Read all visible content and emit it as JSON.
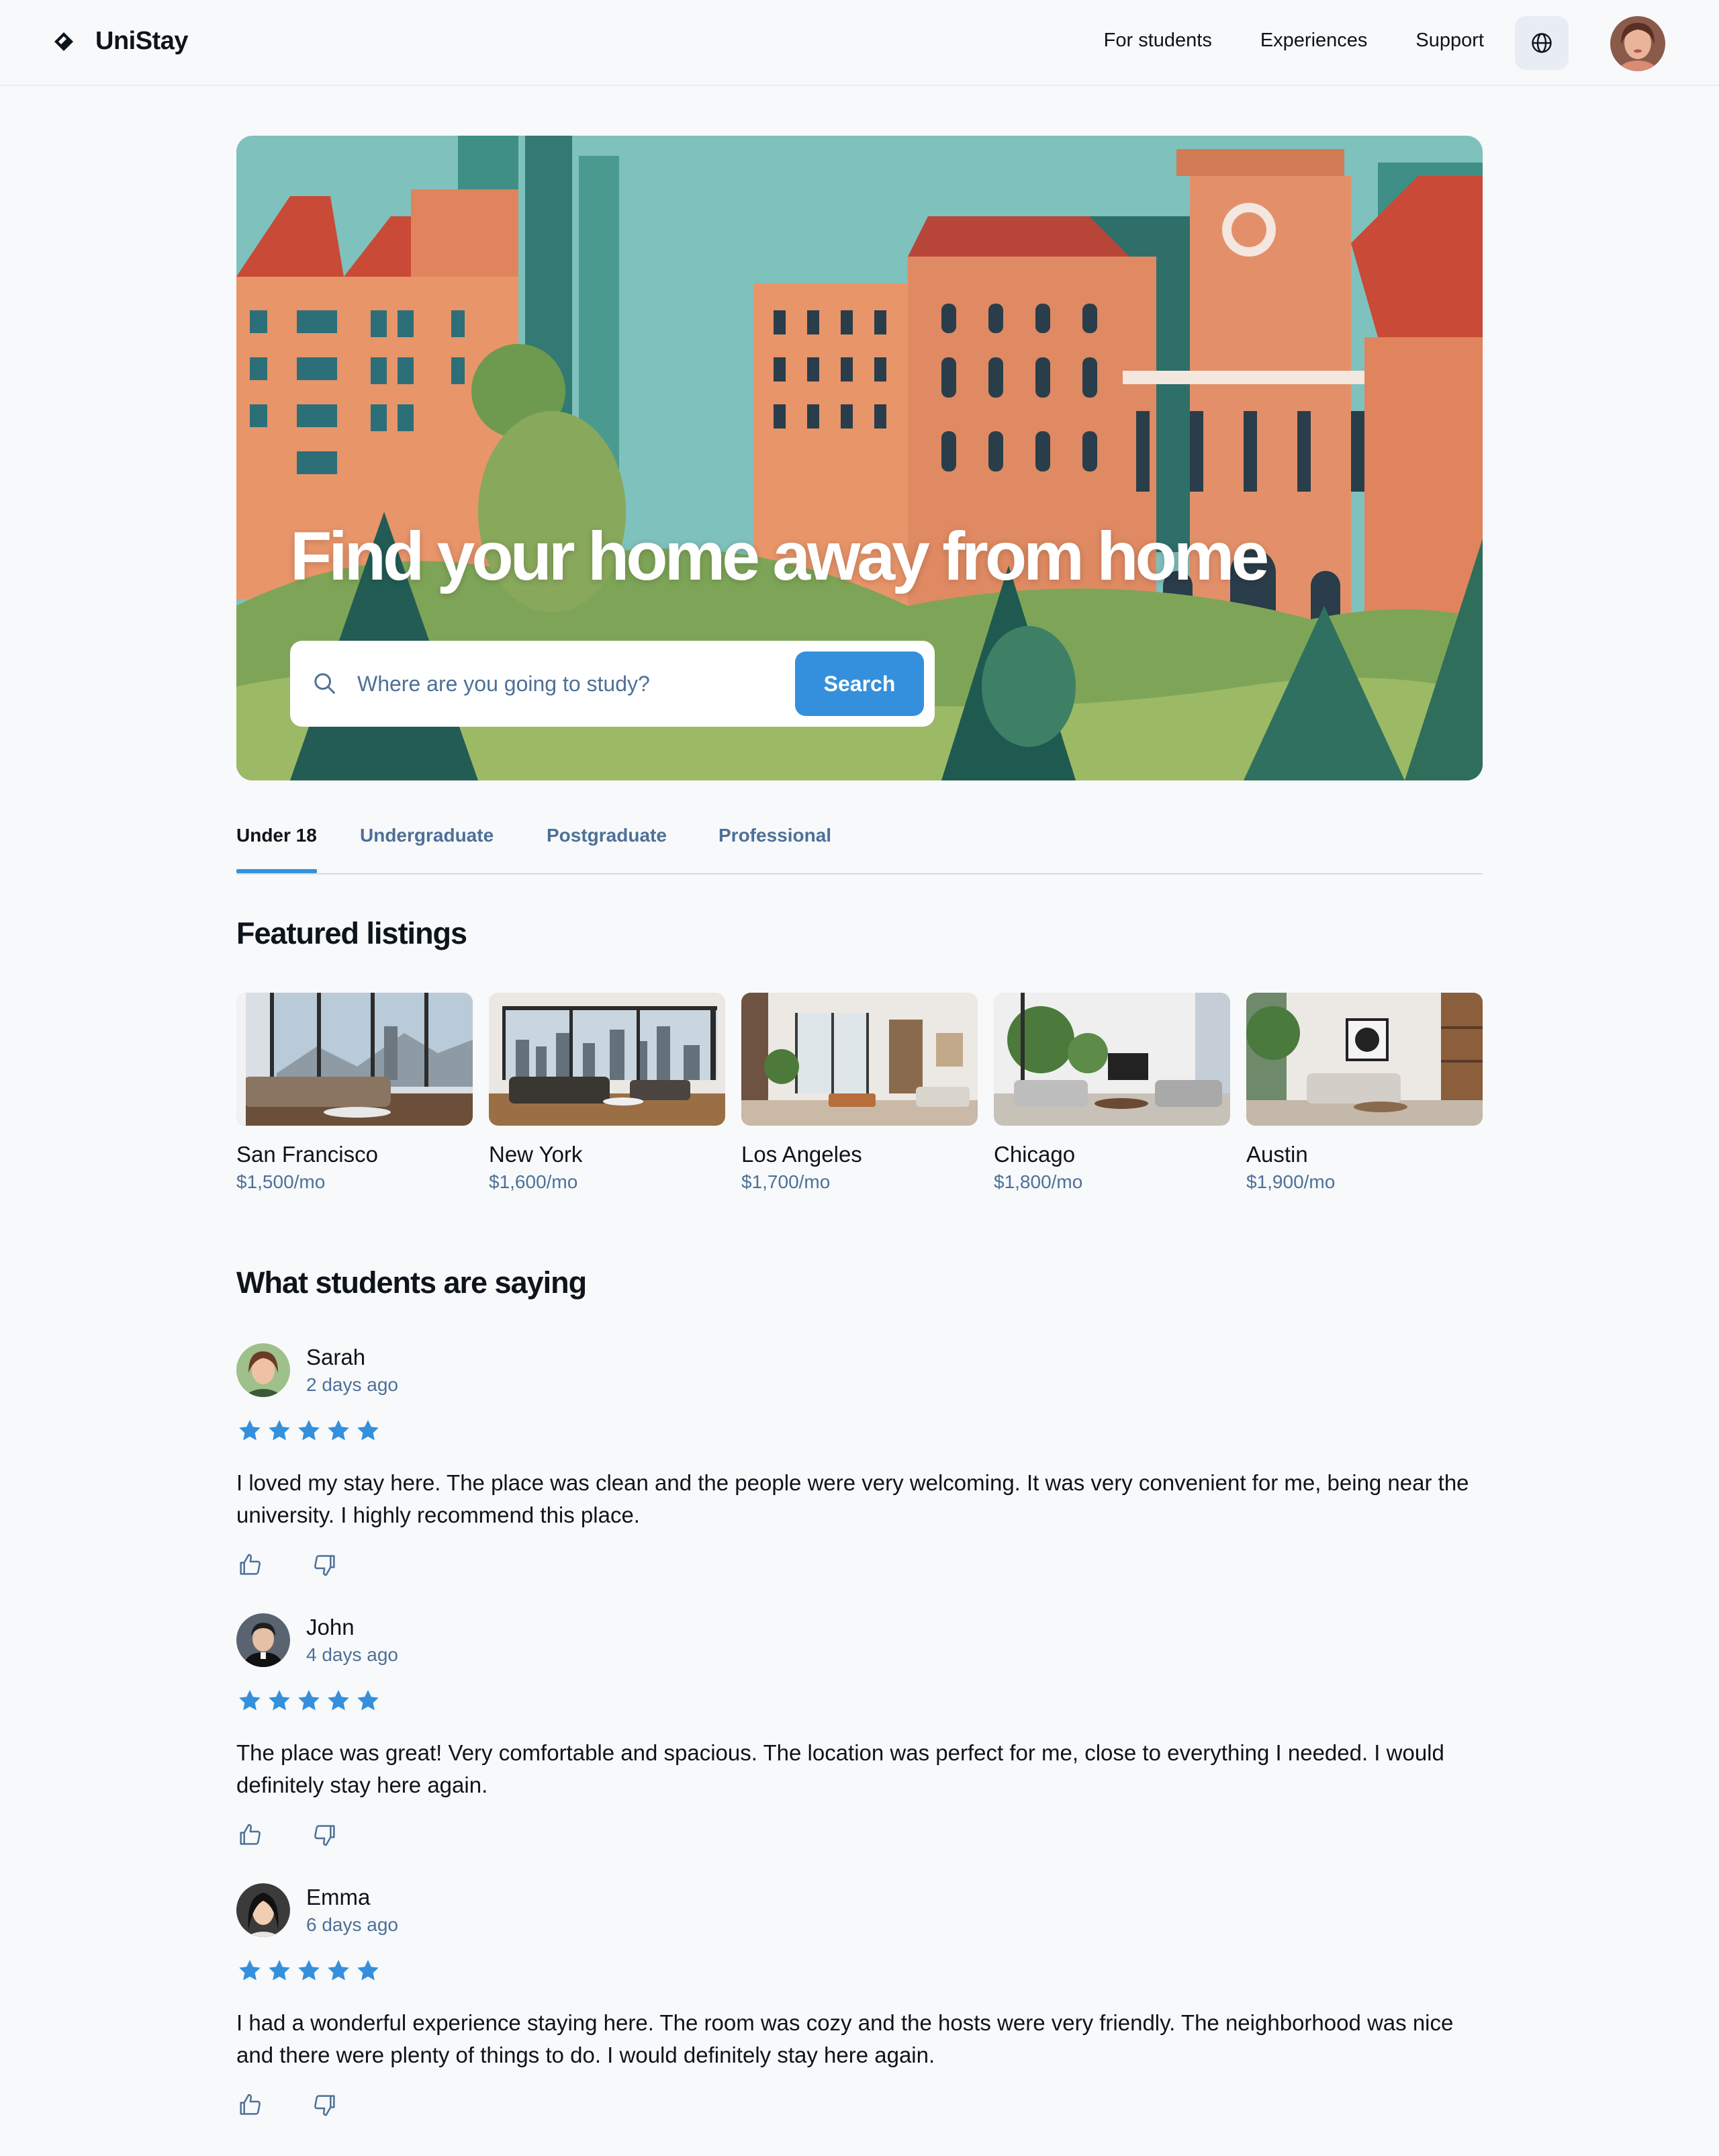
{
  "header": {
    "brand": "UniStay",
    "logo_icon": "diamond-logo-icon",
    "nav": [
      "For students",
      "Experiences",
      "Support"
    ],
    "language_icon": "globe-icon",
    "avatar": "user-avatar"
  },
  "hero": {
    "title": "Find your home away from home",
    "search_placeholder": "Where are you going to study?",
    "search_button": "Search",
    "search_icon": "magnifier-icon"
  },
  "tabs": {
    "items": [
      "Under 18",
      "Undergraduate",
      "Postgraduate",
      "Professional"
    ],
    "active_index": 0
  },
  "featured": {
    "title": "Featured listings",
    "listings": [
      {
        "city": "San Francisco",
        "price": "$1,500/mo"
      },
      {
        "city": "New York",
        "price": "$1,600/mo"
      },
      {
        "city": "Los Angeles",
        "price": "$1,700/mo"
      },
      {
        "city": "Chicago",
        "price": "$1,800/mo"
      },
      {
        "city": "Austin",
        "price": "$1,900/mo"
      }
    ]
  },
  "reviews": {
    "title": "What students are saying",
    "items": [
      {
        "name": "Sarah",
        "date": "2 days ago",
        "rating": 5,
        "text": "I loved my stay here. The place was clean and the people were very welcoming. It was very convenient for me, being near the university. I highly recommend this place."
      },
      {
        "name": "John",
        "date": "4 days ago",
        "rating": 5,
        "text": "The place was great! Very comfortable and spacious. The location was perfect for me, close to everything I needed. I would definitely stay here again."
      },
      {
        "name": "Emma",
        "date": "6 days ago",
        "rating": 5,
        "text": "I had a wonderful experience staying here. The room was cozy and the hosts were very friendly. The neighborhood was nice and there were plenty of things to do. I would definitely stay here again."
      }
    ]
  },
  "colors": {
    "accent": "#3490dc",
    "text": "#0e141b",
    "muted": "#4e7097",
    "background": "#f7f9fb"
  }
}
